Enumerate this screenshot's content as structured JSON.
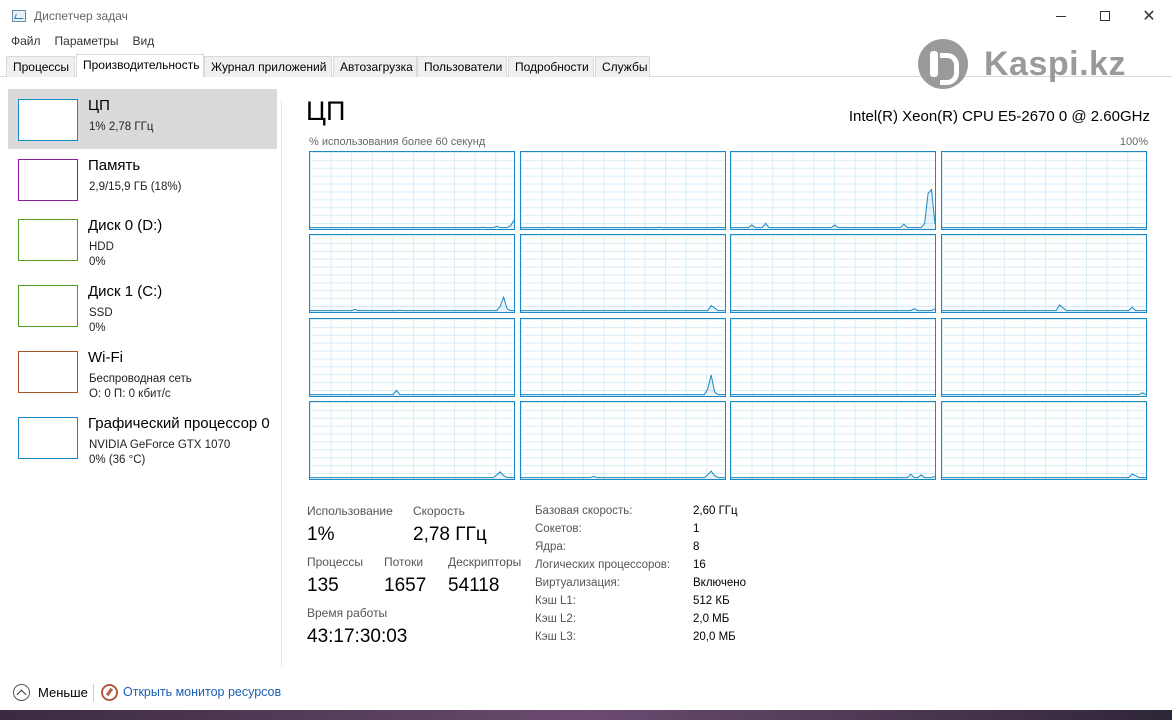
{
  "window": {
    "title": "Диспетчер задач"
  },
  "menu": [
    "Файл",
    "Параметры",
    "Вид"
  ],
  "tabs": [
    {
      "label": "Процессы",
      "active": false
    },
    {
      "label": "Производительность",
      "active": true
    },
    {
      "label": "Журнал приложений",
      "active": false
    },
    {
      "label": "Автозагрузка",
      "active": false
    },
    {
      "label": "Пользователи",
      "active": false
    },
    {
      "label": "Подробности",
      "active": false
    },
    {
      "label": "Службы",
      "active": false
    }
  ],
  "watermark": {
    "text": "Kaspi.kz",
    "color": "#9a9a9a"
  },
  "sidebar": [
    {
      "title": "ЦП",
      "lines": [
        "1% 2,78 ГГц"
      ],
      "color": "#1b8ac4",
      "selected": true
    },
    {
      "title": "Память",
      "lines": [
        "2,9/15,9 ГБ (18%)"
      ],
      "color": "#8b1a9e",
      "selected": false
    },
    {
      "title": "Диск 0 (D:)",
      "lines": [
        "HDD",
        "0%"
      ],
      "color": "#4d9a1f",
      "selected": false
    },
    {
      "title": "Диск 1 (C:)",
      "lines": [
        "SSD",
        "0%"
      ],
      "color": "#4d9a1f",
      "selected": false
    },
    {
      "title": "Wi-Fi",
      "lines": [
        "Беспроводная сеть",
        "О: 0 П: 0 кбит/с"
      ],
      "color": "#a7542a",
      "selected": false
    },
    {
      "title": "Графический процессор 0",
      "lines": [
        "NVIDIA GeForce GTX 1070",
        "0% (36 °C)"
      ],
      "color": "#1b8ac4",
      "selected": false
    }
  ],
  "main": {
    "title": "ЦП",
    "cpu_model": "Intel(R) Xeon(R) CPU E5-2670 0 @ 2.60GHz",
    "graph_label": "% использования более 60 секунд",
    "graph_max": "100%",
    "graph_color": "#1b8ac4",
    "graph_samples": 60,
    "cores": [
      {
        "spikes": [
          [
            50,
            1
          ],
          [
            54,
            2
          ],
          [
            58,
            3
          ],
          [
            59,
            10
          ],
          [
            60,
            2
          ]
        ]
      },
      {
        "spikes": [
          [
            8,
            1
          ],
          [
            40,
            1
          ],
          [
            57,
            1
          ]
        ]
      },
      {
        "spikes": [
          [
            6,
            4
          ],
          [
            10,
            6
          ],
          [
            30,
            4
          ],
          [
            50,
            5
          ],
          [
            56,
            6
          ],
          [
            57,
            45
          ],
          [
            58,
            50
          ],
          [
            59,
            5
          ]
        ]
      },
      {
        "spikes": [
          [
            55,
            1
          ]
        ]
      },
      {
        "spikes": [
          [
            13,
            2
          ],
          [
            26,
            1
          ],
          [
            55,
            6
          ],
          [
            56,
            18
          ],
          [
            57,
            3
          ]
        ]
      },
      {
        "spikes": [
          [
            55,
            7
          ],
          [
            56,
            4
          ]
        ]
      },
      {
        "spikes": [
          [
            53,
            3
          ],
          [
            59,
            3
          ]
        ]
      },
      {
        "spikes": [
          [
            34,
            8
          ],
          [
            35,
            4
          ],
          [
            55,
            5
          ]
        ]
      },
      {
        "spikes": [
          [
            25,
            6
          ]
        ]
      },
      {
        "spikes": [
          [
            54,
            8
          ],
          [
            55,
            26
          ],
          [
            56,
            4
          ]
        ]
      },
      {
        "spikes": []
      },
      {
        "spikes": [
          [
            58,
            3
          ]
        ]
      },
      {
        "spikes": [
          [
            54,
            4
          ],
          [
            55,
            8
          ],
          [
            56,
            3
          ]
        ]
      },
      {
        "spikes": [
          [
            21,
            2
          ],
          [
            54,
            4
          ],
          [
            55,
            9
          ],
          [
            56,
            3
          ]
        ]
      },
      {
        "spikes": [
          [
            52,
            5
          ],
          [
            55,
            4
          ],
          [
            59,
            2
          ]
        ]
      },
      {
        "spikes": [
          [
            55,
            5
          ],
          [
            56,
            3
          ]
        ]
      }
    ],
    "stats": {
      "usage_label": "Использование",
      "usage_value": "1%",
      "speed_label": "Скорость",
      "speed_value": "2,78 ГГц",
      "processes_label": "Процессы",
      "processes_value": "135",
      "threads_label": "Потоки",
      "threads_value": "1657",
      "handles_label": "Дескрипторы",
      "handles_value": "54118",
      "uptime_label": "Время работы",
      "uptime_value": "43:17:30:03"
    },
    "info": [
      {
        "label": "Базовая скорость:",
        "value": "2,60 ГГц"
      },
      {
        "label": "Сокетов:",
        "value": "1"
      },
      {
        "label": "Ядра:",
        "value": "8"
      },
      {
        "label": "Логических процессоров:",
        "value": "16"
      },
      {
        "label": "Виртуализация:",
        "value": "Включено"
      },
      {
        "label": "Кэш L1:",
        "value": "512 КБ"
      },
      {
        "label": "Кэш L2:",
        "value": "2,0 МБ"
      },
      {
        "label": "Кэш L3:",
        "value": "20,0 МБ"
      }
    ]
  },
  "footer": {
    "less_label": "Меньше",
    "monitor_label": "Открыть монитор ресурсов"
  }
}
